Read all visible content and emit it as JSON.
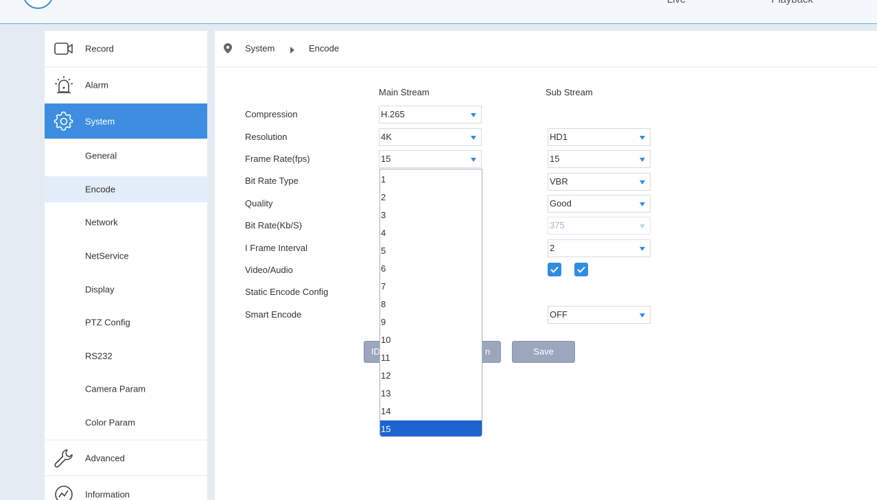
{
  "header": {
    "live_label": "Live",
    "playback_label": "Playback"
  },
  "sidebar": {
    "main_items": [
      {
        "label": "Record",
        "icon": "camera-icon"
      },
      {
        "label": "Alarm",
        "icon": "alarm-icon"
      },
      {
        "label": "System",
        "icon": "gear-icon",
        "active": true
      },
      {
        "label": "Advanced",
        "icon": "wrench-icon"
      },
      {
        "label": "Information",
        "icon": "info-chart-icon"
      }
    ],
    "sub_items": [
      {
        "label": "General"
      },
      {
        "label": "Encode",
        "active": true
      },
      {
        "label": "Network"
      },
      {
        "label": "NetService"
      },
      {
        "label": "Display"
      },
      {
        "label": "PTZ Config"
      },
      {
        "label": "RS232"
      },
      {
        "label": "Camera Param"
      },
      {
        "label": "Color Param"
      }
    ]
  },
  "breadcrumb": {
    "pin_icon": "location-pin-icon",
    "level1": "System",
    "level2": "Encode"
  },
  "form": {
    "main_stream_header": "Main Stream",
    "sub_stream_header": "Sub Stream",
    "rows": {
      "compression": {
        "label": "Compression",
        "main": "H.265"
      },
      "resolution": {
        "label": "Resolution",
        "main": "4K",
        "sub": "HD1"
      },
      "frame_rate": {
        "label": "Frame Rate(fps)",
        "main": "15",
        "sub": "15"
      },
      "bit_rate_type": {
        "label": "Bit Rate Type",
        "sub": "VBR"
      },
      "quality": {
        "label": "Quality",
        "sub": "Good"
      },
      "bit_rate": {
        "label": "Bit Rate(Kb/S)",
        "sub": "375"
      },
      "i_frame": {
        "label": "I Frame Interval",
        "sub": "2"
      },
      "video_audio": {
        "label": "Video/Audio",
        "sub_video": true,
        "sub_audio": true
      },
      "static_encode": {
        "label": "Static Encode Config"
      },
      "smart_encode": {
        "label": "Smart Encode",
        "sub": "OFF"
      }
    },
    "buttons": {
      "left_partial": "ID",
      "middle_partial": "n",
      "save": "Save"
    }
  },
  "frame_rate_dropdown": {
    "options": [
      "1",
      "2",
      "3",
      "4",
      "5",
      "6",
      "7",
      "8",
      "9",
      "10",
      "11",
      "12",
      "13",
      "14",
      "15"
    ],
    "selected": "15"
  },
  "colors": {
    "accent": "#3d8ee0",
    "selected_option": "#1d64d1",
    "button": "#9aa7bd"
  }
}
